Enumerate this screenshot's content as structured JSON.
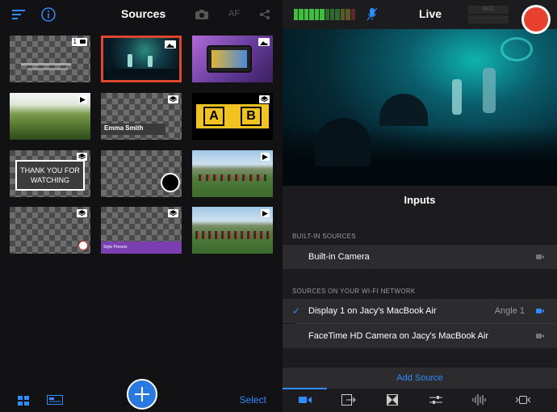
{
  "sources_panel": {
    "title": "Sources",
    "af_label": "AF",
    "select_label": "Select",
    "thumbs": [
      {
        "badge": "1"
      },
      {
        "selected": true
      },
      {},
      {},
      {
        "lower_third": "Emma Smith"
      },
      {
        "letters": [
          "A",
          "B"
        ]
      },
      {
        "thank_you": "THANK YOU FOR WATCHING"
      },
      {},
      {},
      {},
      {
        "caption": "Style Presets"
      },
      {}
    ]
  },
  "live_panel": {
    "title": "Live",
    "rec_label": "REC",
    "inputs_title": "Inputs",
    "builtin_header": "BUILT-IN SOURCES",
    "builtin_camera": "Built-in Camera",
    "wifi_header": "SOURCES ON YOUR WI-FI NETWORK",
    "display_source": "Display 1 on Jacy's MacBook Air",
    "display_angle": "Angle 1",
    "facetime_source": "FaceTime HD Camera on Jacy's MacBook Air",
    "add_source": "Add Source"
  },
  "colors": {
    "accent": "#2f8bff",
    "record": "#e8412f",
    "selection": "#e0452f"
  },
  "icons": [
    "menu-icon",
    "info-icon",
    "camera-icon",
    "share-icon",
    "mic-off-icon",
    "grid-view-icon",
    "list-view-icon",
    "video-icon",
    "output-icon",
    "transition-icon",
    "adjust-icon",
    "audio-icon",
    "switch-icon"
  ]
}
